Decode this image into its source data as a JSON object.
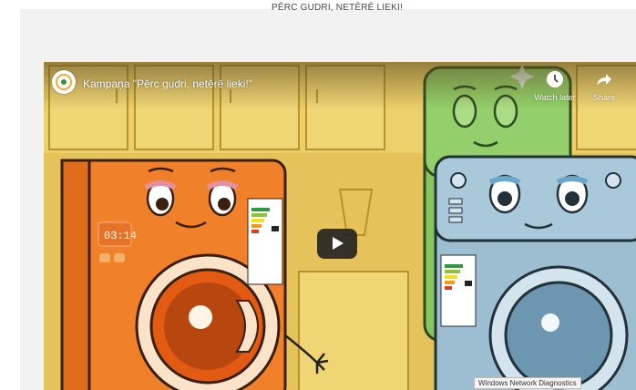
{
  "page": {
    "caption": "PĒRC GUDRI, NETĒRĒ LIEKI!"
  },
  "video": {
    "title": "Kampaņa \"Pērc gudri, netērē lieki!\"",
    "watch_later_label": "Watch later",
    "share_label": "Share",
    "display_clock": "03:14"
  },
  "tooltip": {
    "text": "Windows Network Diagnostics"
  },
  "colors": {
    "scene_wall": "#e8c65b",
    "washer_orange": "#f0812a",
    "fridge_green": "#7fc25b",
    "washer_blue": "#8fb2c6"
  },
  "icons": [
    "channel-avatar",
    "clock-icon",
    "share-arrow-icon",
    "play-icon",
    "sparkle-icon"
  ]
}
